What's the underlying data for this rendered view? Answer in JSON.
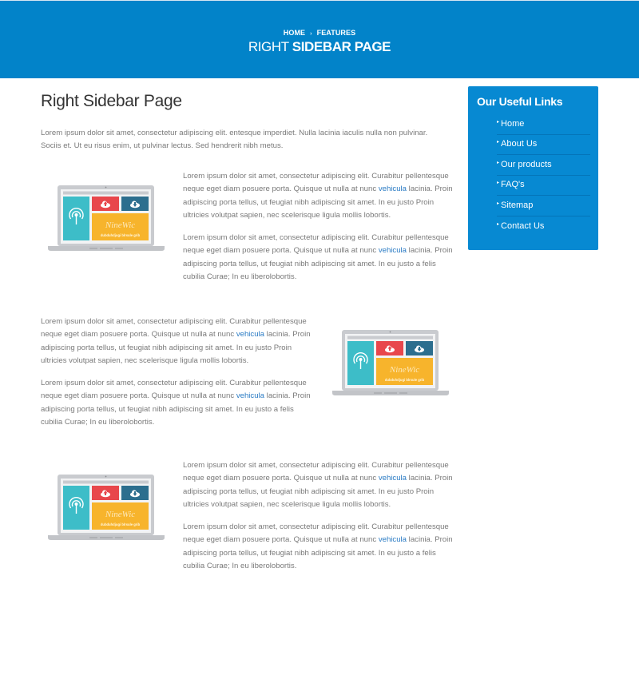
{
  "header": {
    "breadcrumb": [
      "HOME",
      "FEATURES"
    ],
    "breadcrumb_separator": "›",
    "title_light": "RIGHT ",
    "title_bold": "SIDEBAR PAGE",
    "background_color": "#0283c9"
  },
  "content": {
    "title": "Right Sidebar Page",
    "intro": "Lorem ipsum dolor sit amet, consectetur adipiscing elit. entesque imperdiet. Nulla lacinia iaculis nulla non pulvinar. Sociis et. Ut eu risus enim, ut pulvinar lectus. Sed hendrerit nibh metus.",
    "sections": [
      {
        "image_side": "left",
        "image_label": "laptop-illustration",
        "paragraphs": [
          {
            "before": "Lorem ipsum dolor sit amet, consectetur adipiscing elit. Curabitur pellentesque neque eget diam posuere porta. Quisque ut nulla at nunc ",
            "link": "vehicula",
            "after": " lacinia. Proin adipiscing porta tellus, ut feugiat nibh adipiscing sit amet. In eu justo Proin ultricies volutpat sapien, nec scelerisque ligula mollis lobortis."
          },
          {
            "before": "Lorem ipsum dolor sit amet, consectetur adipiscing elit. Curabitur pellentesque neque eget diam posuere porta. Quisque ut nulla at nunc ",
            "link": "vehicula",
            "after": " lacinia. Proin adipiscing porta tellus, ut feugiat nibh adipiscing sit amet. In eu justo a felis cubilia Curae; In eu liberolobortis."
          }
        ]
      },
      {
        "image_side": "right",
        "image_label": "laptop-illustration",
        "paragraphs": [
          {
            "before": "Lorem ipsum dolor sit amet, consectetur adipiscing elit. Curabitur pellentesque neque eget diam posuere porta. Quisque ut nulla at nunc ",
            "link": "vehicula",
            "after": " lacinia. Proin adipiscing porta tellus, ut feugiat nibh adipiscing sit amet. In eu justo Proin ultricies volutpat sapien, nec scelerisque ligula mollis lobortis."
          },
          {
            "before": "Lorem ipsum dolor sit amet, consectetur adipiscing elit. Curabitur pellentesque neque eget diam posuere porta. Quisque ut nulla at nunc ",
            "link": "vehicula",
            "after": " lacinia. Proin adipiscing porta tellus, ut feugiat nibh adipiscing sit amet. In eu justo a felis cubilia Curae; In eu liberolobortis."
          }
        ]
      },
      {
        "image_side": "left",
        "image_label": "laptop-illustration",
        "paragraphs": [
          {
            "before": "Lorem ipsum dolor sit amet, consectetur adipiscing elit. Curabitur pellentesque neque eget diam posuere porta. Quisque ut nulla at nunc ",
            "link": "vehicula",
            "after": " lacinia. Proin adipiscing porta tellus, ut feugiat nibh adipiscing sit amet. In eu justo Proin ultricies volutpat sapien, nec scelerisque ligula mollis lobortis."
          },
          {
            "before": "Lorem ipsum dolor sit amet, consectetur adipiscing elit. Curabitur pellentesque neque eget diam posuere porta. Quisque ut nulla at nunc ",
            "link": "vehicula",
            "after": " lacinia. Proin adipiscing porta tellus, ut feugiat nibh adipiscing sit amet. In eu justo a felis cubilia Curae; In eu liberolobortis."
          }
        ]
      }
    ],
    "link_color": "#2a7bc4",
    "laptop_screen": {
      "brand_text": "NineWic",
      "tagline_text": "dubduhdjugi blrsule grib",
      "tile_colors": {
        "teal": "#3dbdc8",
        "red": "#e8474c",
        "navy": "#2c6e8e",
        "yellow": "#f7b42c"
      }
    }
  },
  "sidebar": {
    "title": "Our Useful Links",
    "arrow_glyph": "▸",
    "links": [
      "Home",
      "About Us",
      "Our products",
      "FAQ's",
      "Sitemap",
      "Contact Us"
    ],
    "background_color": "#0789d2"
  }
}
